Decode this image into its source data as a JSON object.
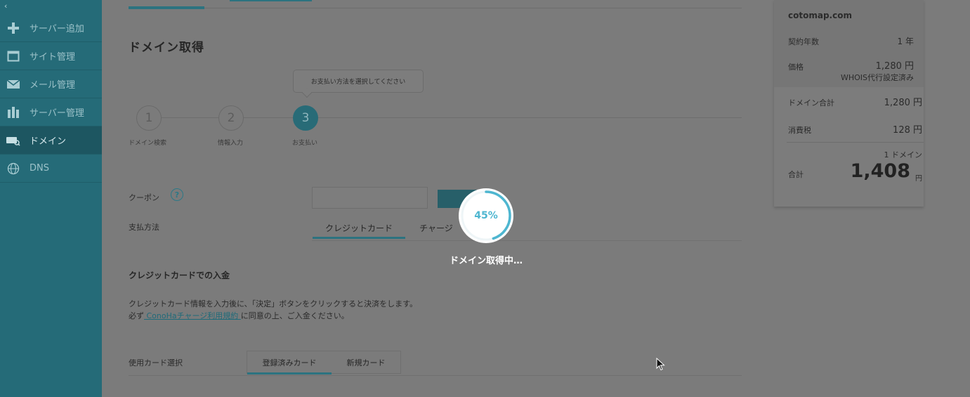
{
  "sidebar": {
    "collapse_glyph": "‹",
    "items": [
      {
        "label": "サーバー追加",
        "icon": "plus-icon"
      },
      {
        "label": "サイト管理",
        "icon": "window-icon"
      },
      {
        "label": "メール管理",
        "icon": "mail-icon"
      },
      {
        "label": "サーバー管理",
        "icon": "server-icon"
      },
      {
        "label": "ドメイン",
        "icon": "domain-icon",
        "active": true
      },
      {
        "label": "DNS",
        "icon": "globe-icon"
      }
    ]
  },
  "main": {
    "title": "ドメイン取得",
    "tooltip": "お支払い方法を選択してください",
    "steps": [
      {
        "number": "1",
        "label": "ドメイン検索"
      },
      {
        "number": "2",
        "label": "情報入力"
      },
      {
        "number": "3",
        "label": "お支払い",
        "current": true
      }
    ],
    "coupon_label": "クーポン",
    "help_glyph": "?",
    "payment_label": "支払方法",
    "payment_tabs": [
      "クレジットカード",
      "チャージ"
    ],
    "credit_section_title": "クレジットカードでの入金",
    "desc_line1": "クレジットカード情報を入力後に、「決定」ボタンをクリックすると決済をします。",
    "desc_line2_pre": "必ず",
    "desc_link": " ConoHaチャージ利用規約 ",
    "desc_line2_post": "に同意の上、ご入金ください。",
    "card_select_label": "使用カード選択",
    "card_tabs": [
      "登録済みカード",
      "新規カード"
    ]
  },
  "summary": {
    "domain": "cotomap.com",
    "contract_years_label": "契約年数",
    "contract_years_value": "1 年",
    "price_label": "価格",
    "price_value": "1,280 円",
    "whois_note": "WHOIS代行設定済み",
    "domain_total_label": "ドメイン合計",
    "domain_total_value": "1,280 円",
    "tax_label": "消費税",
    "tax_value": "128 円",
    "domain_count": "1 ドメイン",
    "total_label": "合計",
    "total_value": "1,408",
    "total_unit": "円"
  },
  "loading": {
    "percent_text": "45%",
    "progress": 0.45,
    "text": "ドメイン取得中…",
    "color": "#4eb6d0"
  }
}
